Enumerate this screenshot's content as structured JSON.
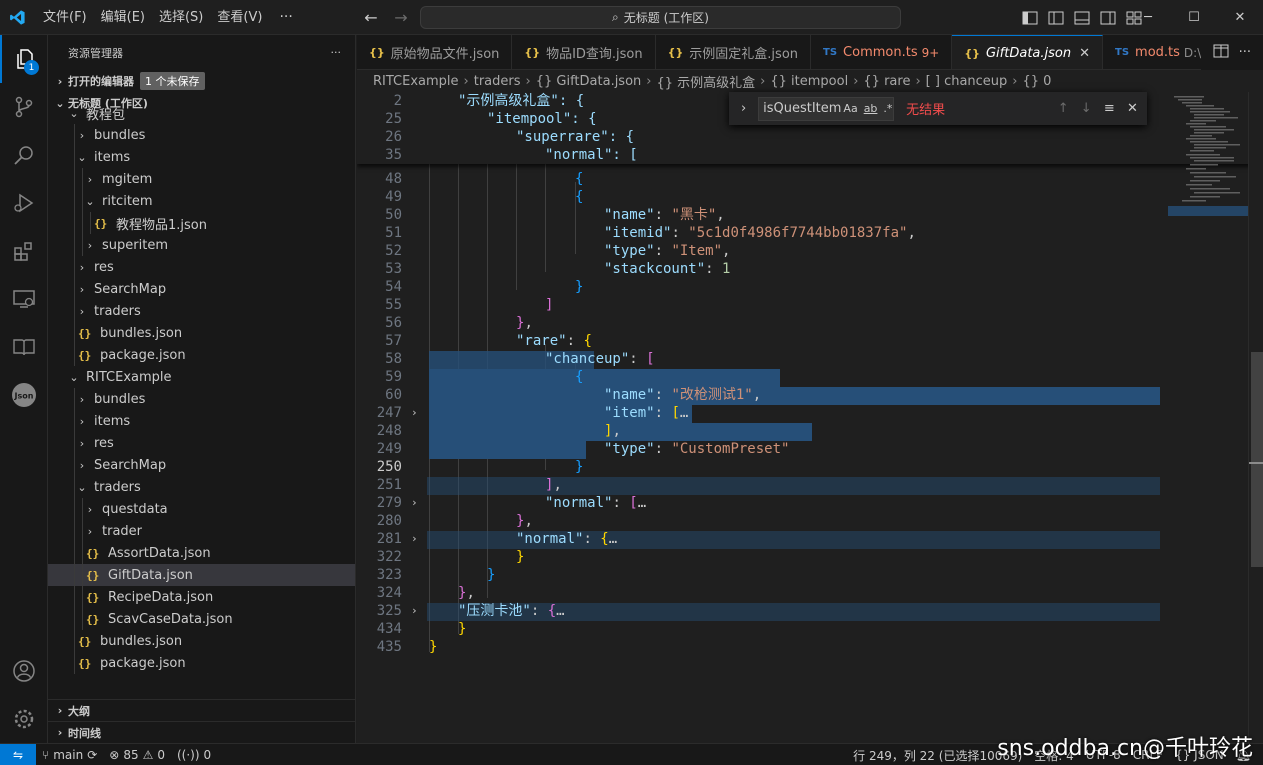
{
  "titlebar": {
    "menus": [
      "文件(F)",
      "编辑(E)",
      "选择(S)",
      "查看(V)"
    ],
    "more": "···",
    "command_center": "无标题 (工作区)",
    "window_buttons": [
      "minimize-icon",
      "maximize-icon",
      "close-icon"
    ]
  },
  "activitybar": {
    "explorer_badge": "1"
  },
  "sidebar": {
    "title": "资源管理器",
    "more": "···",
    "open_editors": "打开的编辑器",
    "unsaved": "1 个未保存",
    "workspace": "无标题 (工作区)",
    "tree": [
      {
        "label": "教程包",
        "chev": "∨",
        "indent": 1,
        "type": "folder"
      },
      {
        "label": "bundles",
        "chev": ">",
        "indent": 2,
        "type": "folder"
      },
      {
        "label": "items",
        "chev": "∨",
        "indent": 2,
        "type": "folder"
      },
      {
        "label": "mgitem",
        "chev": ">",
        "indent": 3,
        "type": "folder"
      },
      {
        "label": "ritcitem",
        "chev": "∨",
        "indent": 3,
        "type": "folder"
      },
      {
        "label": "教程物品1.json",
        "chev": "",
        "indent": 4,
        "type": "json"
      },
      {
        "label": "superitem",
        "chev": ">",
        "indent": 3,
        "type": "folder"
      },
      {
        "label": "res",
        "chev": ">",
        "indent": 2,
        "type": "folder"
      },
      {
        "label": "SearchMap",
        "chev": ">",
        "indent": 2,
        "type": "folder"
      },
      {
        "label": "traders",
        "chev": ">",
        "indent": 2,
        "type": "folder"
      },
      {
        "label": "bundles.json",
        "chev": "",
        "indent": 2,
        "type": "json"
      },
      {
        "label": "package.json",
        "chev": "",
        "indent": 2,
        "type": "json"
      },
      {
        "label": "RITCExample",
        "chev": "∨",
        "indent": 1,
        "type": "folder"
      },
      {
        "label": "bundles",
        "chev": ">",
        "indent": 2,
        "type": "folder"
      },
      {
        "label": "items",
        "chev": ">",
        "indent": 2,
        "type": "folder"
      },
      {
        "label": "res",
        "chev": ">",
        "indent": 2,
        "type": "folder"
      },
      {
        "label": "SearchMap",
        "chev": ">",
        "indent": 2,
        "type": "folder"
      },
      {
        "label": "traders",
        "chev": "∨",
        "indent": 2,
        "type": "folder"
      },
      {
        "label": "questdata",
        "chev": ">",
        "indent": 3,
        "type": "folder"
      },
      {
        "label": "trader",
        "chev": ">",
        "indent": 3,
        "type": "folder"
      },
      {
        "label": "AssortData.json",
        "chev": "",
        "indent": 3,
        "type": "json"
      },
      {
        "label": "GiftData.json",
        "chev": "",
        "indent": 3,
        "type": "json",
        "selected": true
      },
      {
        "label": "RecipeData.json",
        "chev": "",
        "indent": 3,
        "type": "json"
      },
      {
        "label": "ScavCaseData.json",
        "chev": "",
        "indent": 3,
        "type": "json"
      },
      {
        "label": "bundles.json",
        "chev": "",
        "indent": 2,
        "type": "json"
      },
      {
        "label": "package.json",
        "chev": "",
        "indent": 2,
        "type": "json"
      }
    ],
    "outline": "大纲",
    "timeline": "时间线"
  },
  "tabs": [
    {
      "label": "原始物品文件.json",
      "icon": "{}",
      "kind": "json"
    },
    {
      "label": "物品ID查询.json",
      "icon": "{}",
      "kind": "json"
    },
    {
      "label": "示例固定礼盒.json",
      "icon": "{}",
      "kind": "json"
    },
    {
      "label": "Common.ts",
      "icon": "TS",
      "kind": "ts",
      "desc": "9+",
      "warn": true
    },
    {
      "label": "GiftData.json",
      "icon": "{}",
      "kind": "json",
      "active": true,
      "close": "✕"
    },
    {
      "label": "mod.ts",
      "icon": "TS",
      "kind": "ts",
      "desc": "D:\\",
      "warn": true
    }
  ],
  "breadcrumb": [
    "RITCExample",
    "traders",
    "{} GiftData.json",
    "{} 示例高级礼盒",
    "{} itempool",
    "{} rare",
    "[ ] chanceup",
    "{} 0"
  ],
  "find": {
    "value": "isQuestItem",
    "opt_case": "Aa",
    "opt_word": "ab",
    "opt_regex": ".*",
    "result": "无结果"
  },
  "editor": {
    "sticky": [
      {
        "ln": "2",
        "text": "\"示例高级礼盒\": {"
      },
      {
        "ln": "25",
        "text": "\"itempool\": {"
      },
      {
        "ln": "26",
        "text": "\"superrare\": {"
      },
      {
        "ln": "35",
        "text": "\"normal\": ["
      }
    ],
    "line_numbers": [
      "48",
      "49",
      "50",
      "51",
      "52",
      "53",
      "54",
      "55",
      "56",
      "57",
      "58",
      "59",
      "60",
      "247",
      "248",
      "249",
      "250",
      "251",
      "279",
      "280",
      "281",
      "322",
      "323",
      "324",
      "325",
      "434",
      "435"
    ],
    "strings": {
      "name_key": "\"name\"",
      "name1": "\"黑卡\"",
      "itemid_key": "\"itemid\"",
      "itemid": "\"5c1d0f4986f7744bb01837fa\"",
      "type_key": "\"type\"",
      "type_item": "\"Item\"",
      "stackcount_key": "\"stackcount\"",
      "stackcount": "1",
      "rare_key": "\"rare\"",
      "chanceup_key": "\"chanceup\"",
      "name2": "\"改枪测试1\"",
      "item_key": "\"item\"",
      "type_custom": "\"CustomPreset\"",
      "normal_key": "\"normal\"",
      "pool_key": "\"压测卡池\"",
      "ellipsis": "…"
    }
  },
  "status": {
    "branch": "main",
    "errors": "85",
    "warnings": "0",
    "ports": "0",
    "position": "行 249，列 22 (已选择10069)",
    "spaces": "空格: 4",
    "encoding": "UTF-8",
    "eol": "CRLF",
    "language": "{} JSON",
    "watermark": "sns.oddba.cn@千叶玲花"
  },
  "colors": {
    "accent": "#0078d4",
    "selection": "#264f78",
    "string": "#ce9178",
    "key": "#9cdcfe",
    "error": "#f14c4c"
  }
}
